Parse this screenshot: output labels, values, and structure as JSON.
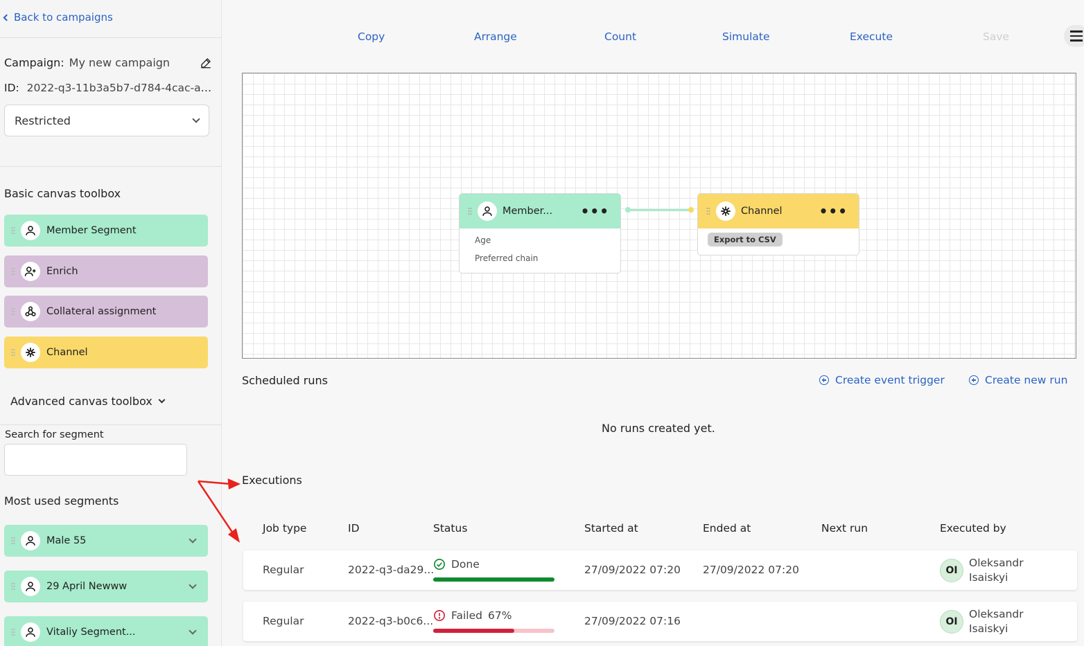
{
  "sidebar": {
    "back_label": "Back to campaigns",
    "campaign_label": "Campaign:",
    "campaign_name": "My new campaign",
    "id_label": "ID:",
    "id_value": "2022-q3-11b3a5b7-d784-4cac-af...",
    "visibility_select": "Restricted",
    "basic_toolbox_title": "Basic canvas toolbox",
    "basic_tools": [
      {
        "label": "Member Segment",
        "icon": "person-icon",
        "color": "#a8ebcd"
      },
      {
        "label": "Enrich",
        "icon": "person-add-icon",
        "color": "#d6bfd9"
      },
      {
        "label": "Collateral assignment",
        "icon": "share-nodes-icon",
        "color": "#d6bfd9"
      },
      {
        "label": "Channel",
        "icon": "asterisk-icon",
        "color": "#fad96a"
      }
    ],
    "advanced_toolbox_label": "Advanced canvas toolbox",
    "search_label": "Search for segment",
    "search_value": "",
    "most_used_title": "Most used segments",
    "most_used": [
      {
        "label": "Male 55"
      },
      {
        "label": "29 April Newww"
      },
      {
        "label": "Vitaliy Segment..."
      }
    ]
  },
  "toolbar": {
    "copy": "Copy",
    "arrange": "Arrange",
    "count": "Count",
    "simulate": "Simulate",
    "execute": "Execute",
    "save": "Save"
  },
  "canvas": {
    "member_node": {
      "title": "Member...",
      "fields": [
        "Age",
        "Preferred chain"
      ]
    },
    "channel_node": {
      "title": "Channel",
      "badge": "Export to CSV"
    }
  },
  "scheduled": {
    "title": "Scheduled runs",
    "create_trigger": "Create event trigger",
    "create_run": "Create new run",
    "empty": "No runs created yet."
  },
  "executions": {
    "title": "Executions",
    "columns": [
      "Job type",
      "ID",
      "Status",
      "Started at",
      "Ended at",
      "Next run",
      "Executed by"
    ],
    "rows": [
      {
        "job_type": "Regular",
        "id": "2022-q3-da29...",
        "status": "Done",
        "progress": "",
        "progress_value": 1.0,
        "started": "27/09/2022 07:20",
        "ended": "27/09/2022 07:20",
        "next_run": "",
        "initials": "OI",
        "first_name": "Oleksandr",
        "last_name": "Isaiskyi"
      },
      {
        "job_type": "Regular",
        "id": "2022-q3-b0c6...",
        "status": "Failed",
        "progress": "67%",
        "progress_value": 0.67,
        "started": "27/09/2022 07:16",
        "ended": "",
        "next_run": "",
        "initials": "OI",
        "first_name": "Oleksandr",
        "last_name": "Isaiskyi"
      }
    ]
  },
  "colors": {
    "link": "#2b62c4",
    "segment_green": "#a8ebcd",
    "enrich_purple": "#d6bfd9",
    "channel_yellow": "#fad96a",
    "done_green": "#0f8a2f",
    "failed_red": "#d0223c",
    "annotation_red": "#e8231e"
  }
}
